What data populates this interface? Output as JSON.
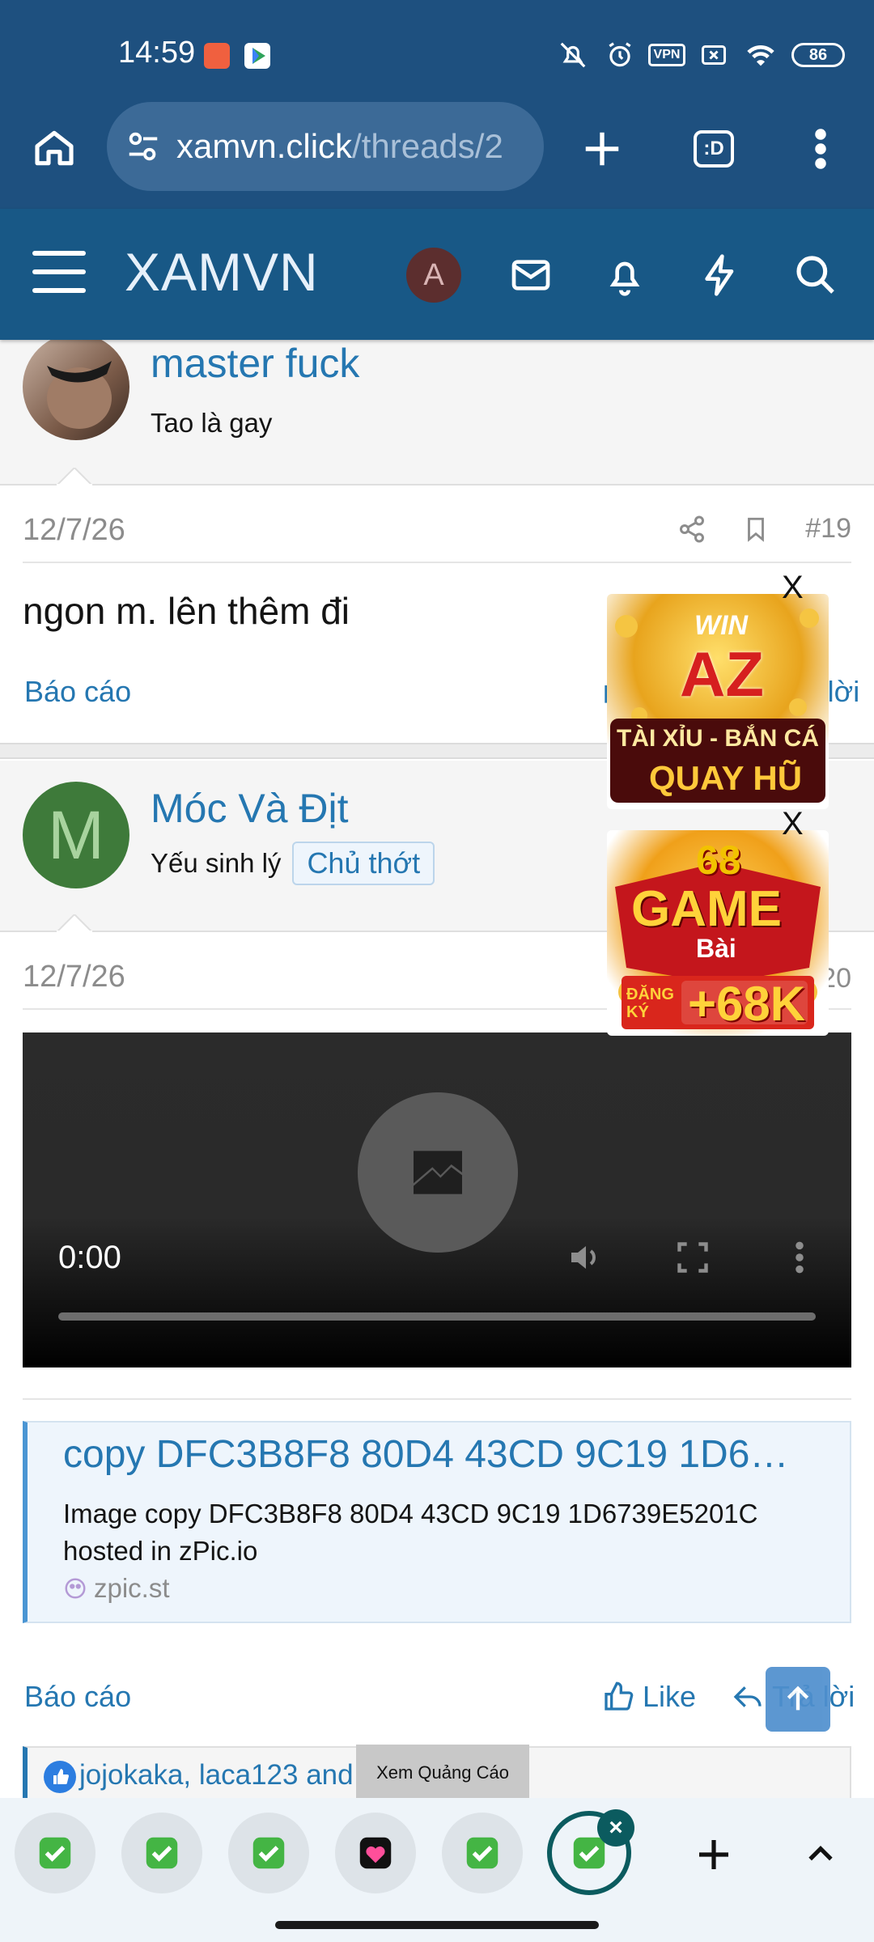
{
  "status_bar": {
    "time": "14:59",
    "battery": "86",
    "vpn_label": "VPN"
  },
  "browser": {
    "url_host": "xamvn.click",
    "url_path": "/threads/2",
    "tab_count_label": ":D"
  },
  "site": {
    "logo": "XAMVN",
    "user_avatar_letter": "A"
  },
  "post1_author": {
    "username": "master fuck",
    "user_title": "Tao là gay"
  },
  "post1": {
    "date": "12/7/26",
    "number": "#19",
    "text": "ngon m. lên thêm đi",
    "report_label": "Báo cáo",
    "reply_label": "Trả lời"
  },
  "post2_author": {
    "avatar_letter": "M",
    "username": "Móc Và Địt",
    "user_title": "Yếu sinh lý",
    "badge": "Chủ thớt"
  },
  "post2": {
    "date": "12/7/26",
    "number": "#20",
    "video_time": "0:00",
    "link_card": {
      "title": "copy DFC3B8F8 80D4 43CD 9C19 1D6…",
      "description": "Image copy DFC3B8F8 80D4 43CD 9C19 1D6739E5201C hosted in zPic.io",
      "domain": "zpic.st"
    },
    "report_label": "Báo cáo",
    "like_label": "Like",
    "reply_label": "Trả lời",
    "reactions_text": "jojokaka, laca123 and",
    "ad_label": "Xem Quảng Cáo"
  },
  "ads": {
    "close_label": "X",
    "ad1": {
      "line1": "WIN",
      "line2": "AZ",
      "line3": "TÀI XỈU - BẮN CÁ",
      "line4": "QUAY HŨ"
    },
    "ad2": {
      "line1": "68",
      "line2": "GAME",
      "line3": "Bài",
      "line4": "ĐĂNG KÝ",
      "line5": "+68K"
    }
  },
  "colors": {
    "browser_chrome": "#1e507f",
    "site_header": "#185886",
    "link": "#2577b1",
    "tab_active_ring": "#0b5b5f"
  }
}
